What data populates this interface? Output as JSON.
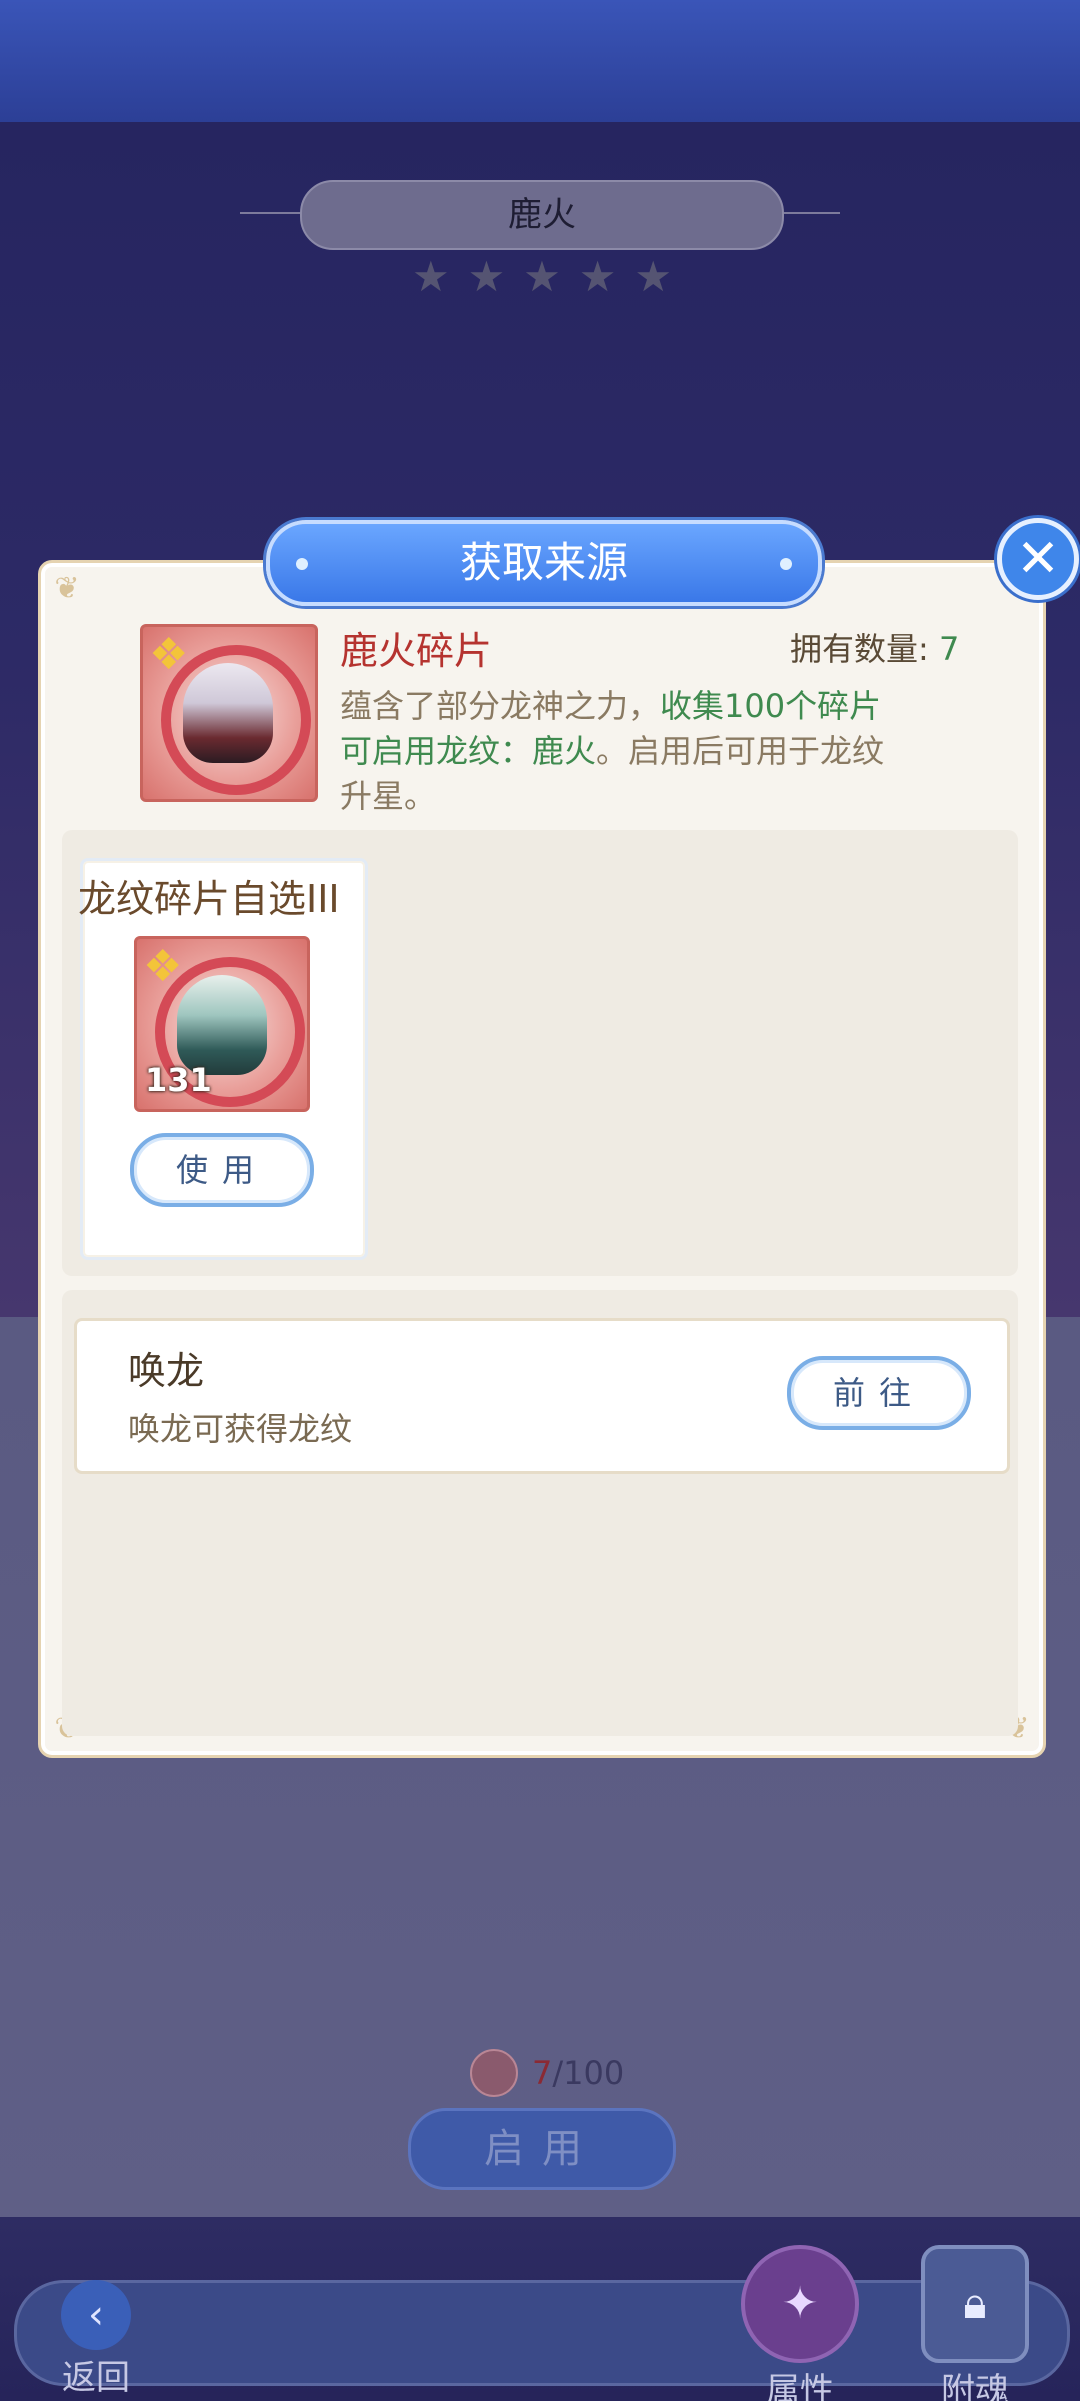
{
  "background": {
    "character_name": "鹿火",
    "star_glyph": "★",
    "stars": 5,
    "fragment_current": "7",
    "fragment_total": "/100",
    "enable_button": "启用",
    "back_label": "返回",
    "attr_label": "属性",
    "soul_label": "附魂"
  },
  "popup": {
    "title": "获取来源",
    "close_glyph": "✕",
    "item": {
      "name": "鹿火碎片",
      "owned_label": "拥有数量:",
      "owned_value": "7",
      "desc_1": "蕴含了部分龙神之力，",
      "desc_2": "收集100个碎片",
      "desc_3": "可启用龙纹：",
      "desc_4": "鹿火",
      "desc_5": "。启用后可用于龙纹",
      "desc_6": "升星。"
    },
    "choice": {
      "title": "龙纹碎片自选III",
      "count": "131",
      "use_button": "使用"
    },
    "route": {
      "title": "唤龙",
      "desc": "唤龙可获得龙纹",
      "go_button": "前往"
    }
  },
  "colors": {
    "accent_blue": "#3a78e8",
    "name_red": "#b5332f",
    "highlight_green": "#3f8a4f"
  }
}
